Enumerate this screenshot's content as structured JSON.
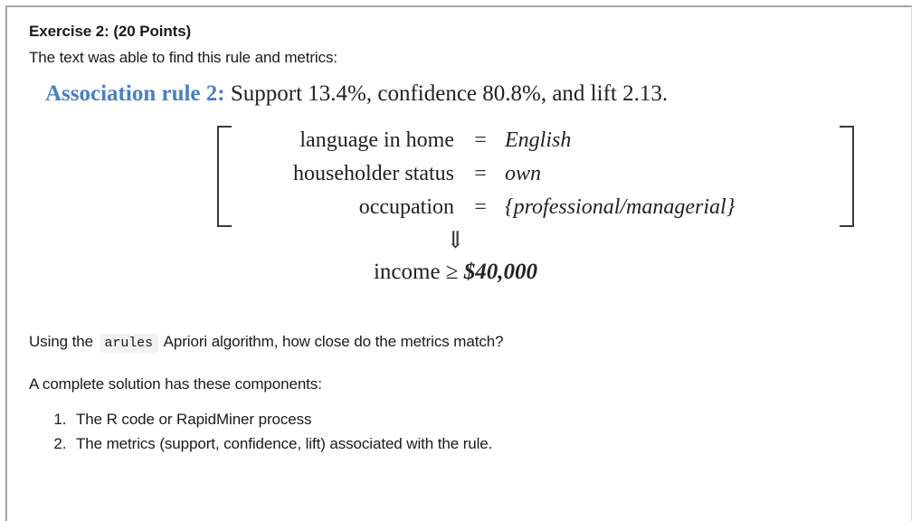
{
  "document": {
    "heading": "Exercise 2: (20 Points)",
    "intro_line": "The text was able to find this rule and metrics:",
    "rule": {
      "label": "Association rule 2:",
      "metrics_text": "Support 13.4%, confidence 80.8%, and lift 2.13.",
      "support": "13.4%",
      "confidence": "80.8%",
      "lift": "2.13",
      "antecedent": [
        {
          "key": "language in home",
          "operator": "=",
          "value": "English"
        },
        {
          "key": "householder status",
          "operator": "=",
          "value": "own"
        },
        {
          "key": "occupation",
          "operator": "=",
          "value": "{professional/managerial}"
        }
      ],
      "implication_symbol": "⇓",
      "consequent": {
        "attribute": "income",
        "operator": "≥",
        "amount": "$40,000"
      }
    },
    "question": {
      "before_code": "Using the",
      "code": "arules",
      "after_code": "Apriori algorithm, how close do the metrics match?"
    },
    "components_intro": "A complete solution has these components:",
    "components": [
      "The R code or RapidMiner process",
      "The metrics (support, confidence, lift) associated with the rule."
    ],
    "colors": {
      "rule_label": "#4a7fc1",
      "text": "#1a1a1a",
      "code_background": "#f2f2f2",
      "frame_border": "#a6a6a6"
    }
  }
}
